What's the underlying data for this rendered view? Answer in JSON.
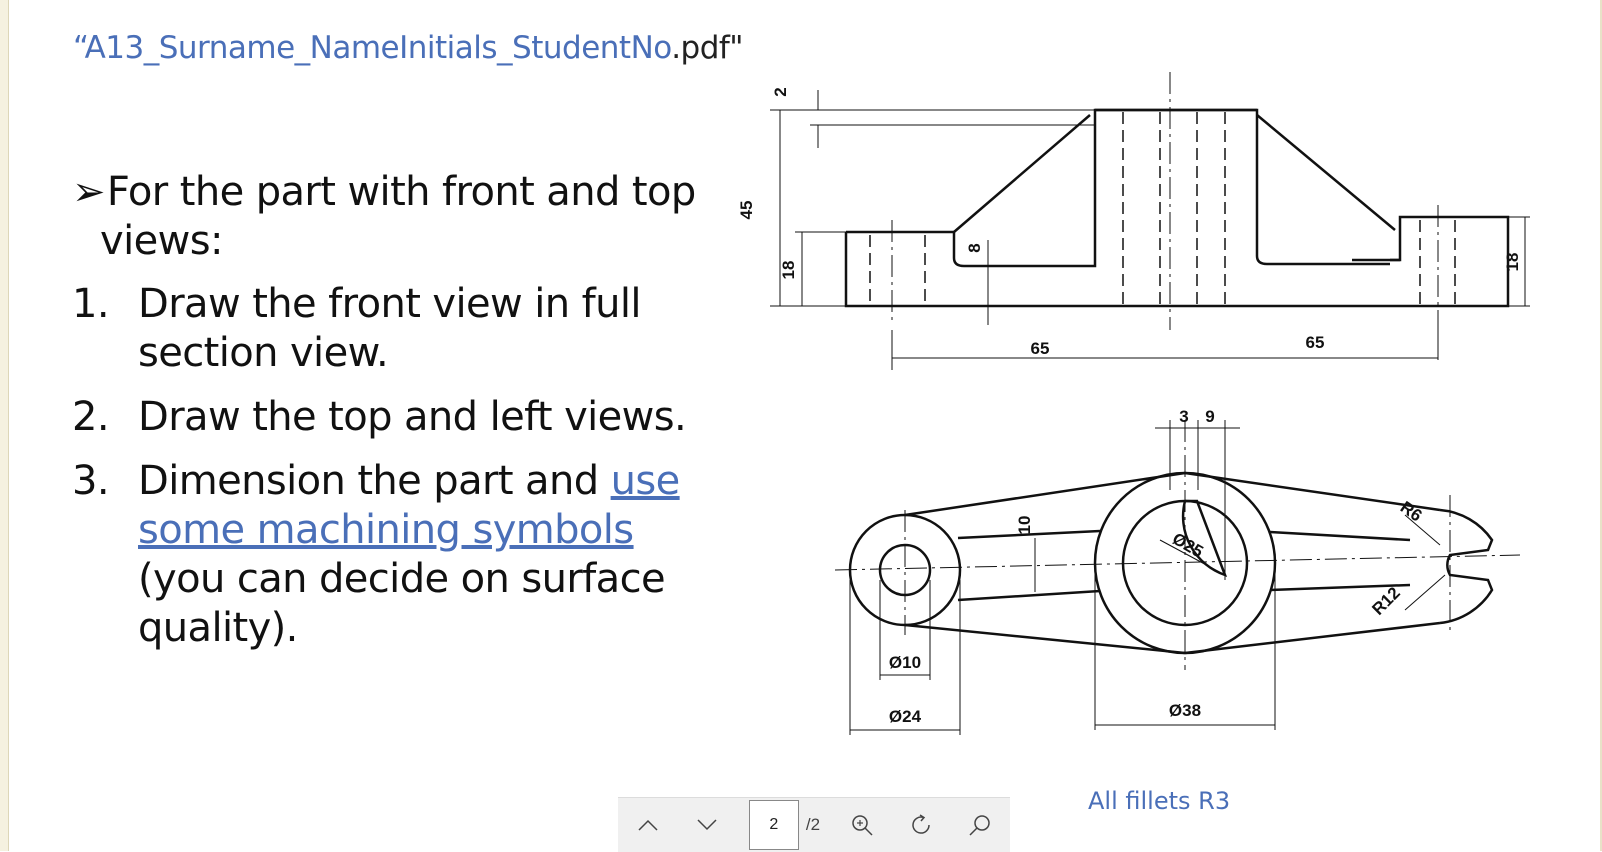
{
  "document": {
    "title_main": "“A13_Surname_NameInitials_StudentNo",
    "title_ext": ".pdf\""
  },
  "task": {
    "intro": "For the part with front and top",
    "intro_line2": "views:",
    "steps": [
      {
        "num": "1.",
        "text": "Draw the front view in full section view."
      },
      {
        "num": "2.",
        "text": "Draw the top and left views."
      },
      {
        "num": "3.",
        "text_before": "Dimension the part and ",
        "link": "use some machining symbols",
        "text_after": " (you can decide on surface quality)."
      }
    ]
  },
  "drawing": {
    "front_view_dims": [
      "2",
      "45",
      "18",
      "8",
      "65",
      "65",
      "18"
    ],
    "top_view_dims": [
      "3",
      "9",
      "10",
      "Ø25",
      "R6",
      "R12",
      "Ø10",
      "Ø24",
      "Ø38"
    ],
    "note": "All fillets R3"
  },
  "toolbar": {
    "page_current": "2",
    "page_total": "/2",
    "icons": [
      "chevron-up-icon",
      "chevron-down-icon",
      "zoom-in-icon",
      "rotate-icon",
      "search-icon"
    ]
  }
}
